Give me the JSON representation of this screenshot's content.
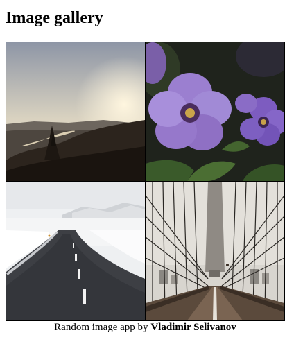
{
  "page": {
    "title": "Image gallery"
  },
  "gallery": {
    "images": [
      {
        "subject": "sunset-mountain-river-landscape"
      },
      {
        "subject": "purple-petunia-flowers"
      },
      {
        "subject": "snowy-road"
      },
      {
        "subject": "suspension-bridge-walkway"
      }
    ]
  },
  "footer": {
    "text": "Random image app by",
    "author": "Vladimir Selivanov"
  },
  "colors": {
    "background": "#ffffff",
    "text": "#000000",
    "grid_border": "#000000"
  }
}
